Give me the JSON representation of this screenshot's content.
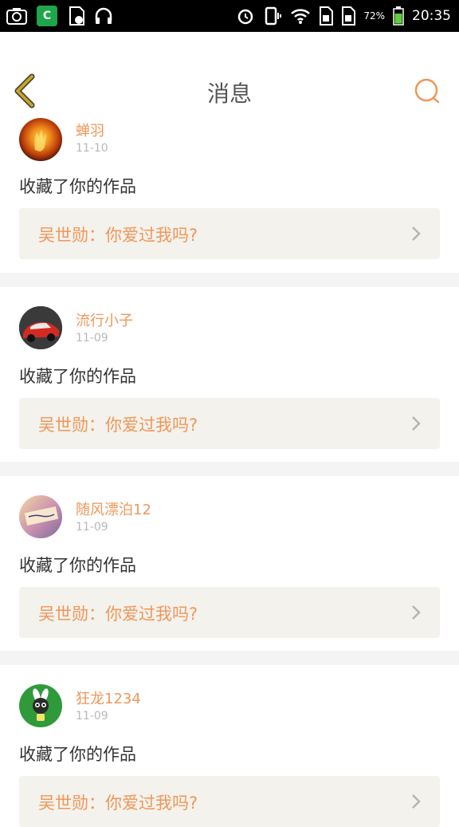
{
  "status_bar": {
    "battery_percent": "72%",
    "time": "20:35",
    "app_badge_letter": "C"
  },
  "header": {
    "title": "消息"
  },
  "messages": [
    {
      "username": "蝉羽",
      "date": "11-10",
      "action": "收藏了你的作品",
      "quote": "吴世勋：你爱过我吗?"
    },
    {
      "username": "流行小子",
      "date": "11-09",
      "action": "收藏了你的作品",
      "quote": "吴世勋：你爱过我吗?"
    },
    {
      "username": "随风漂泊12",
      "date": "11-09",
      "action": "收藏了你的作品",
      "quote": "吴世勋：你爱过我吗?"
    },
    {
      "username": "狂龙1234",
      "date": "11-09",
      "action": "收藏了你的作品",
      "quote": "吴世勋：你爱过我吗?"
    }
  ],
  "colors": {
    "accent": "#f0975a",
    "back_arrow": "#c9a22a",
    "quote_bg": "#f3f2ec",
    "separator": "#f4f4f4"
  },
  "icons": [
    "camera-icon",
    "app-badge-icon",
    "sd-card-icon",
    "headphones-icon",
    "alarm-icon",
    "vibrate-icon",
    "wifi-icon",
    "sim-icon",
    "sim2-icon",
    "battery-icon",
    "back-arrow-icon",
    "search-icon",
    "chevron-right-icon"
  ]
}
